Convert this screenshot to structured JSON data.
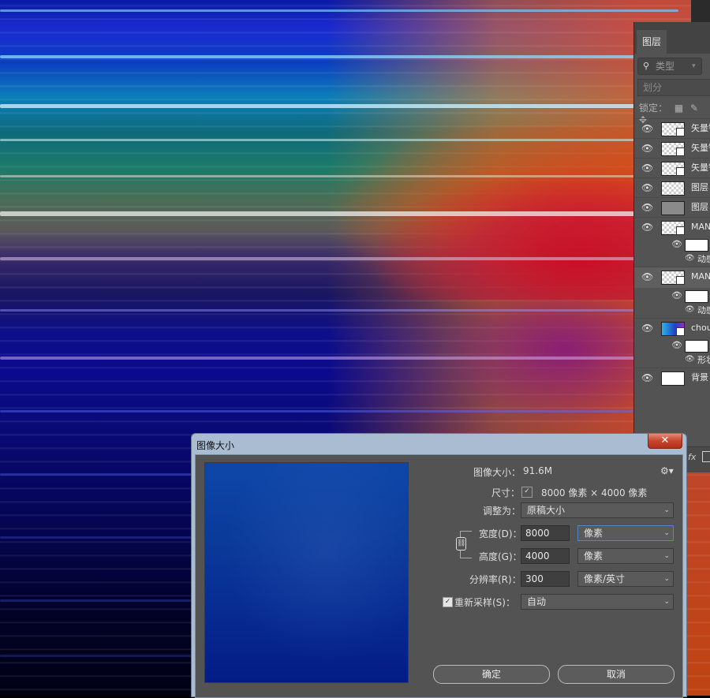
{
  "layers_panel": {
    "tab": "图层",
    "filter_label": "类型",
    "blend_mode": "划分",
    "lock_label": "锁定：",
    "layers": [
      {
        "name": "矢量智能对象"
      },
      {
        "name": "矢量智能对象"
      },
      {
        "name": "矢量智能对象"
      },
      {
        "name": "图层"
      },
      {
        "name": "图层"
      },
      {
        "name": "MANDALA"
      },
      {
        "sub_label": "动感模糊"
      },
      {
        "name": "MANDALA"
      },
      {
        "sub_label": "动感模糊"
      },
      {
        "name": "choux"
      },
      {
        "sub_label": "形状"
      },
      {
        "name": "背景"
      }
    ],
    "bottom_fx": "fx"
  },
  "dialog": {
    "title": "图像大小",
    "close_symbol": "✕",
    "image_size_label": "图像大小：",
    "image_size_value": "91.6M",
    "dimensions_label": "尺寸：",
    "dimensions_value": "8000 像素 × 4000 像素",
    "fit_to_label": "调整为：",
    "fit_to_value": "原稿大小",
    "width_label": "宽度(D)：",
    "width_value": "8000",
    "width_unit": "像素",
    "height_label": "高度(G)：",
    "height_value": "4000",
    "height_unit": "像素",
    "resolution_label": "分辨率(R)：",
    "resolution_value": "300",
    "resolution_unit": "像素/英寸",
    "resample_label": "重新采样(S)：",
    "resample_checked": true,
    "resample_value": "自动",
    "ok_label": "确定",
    "cancel_label": "取消"
  }
}
